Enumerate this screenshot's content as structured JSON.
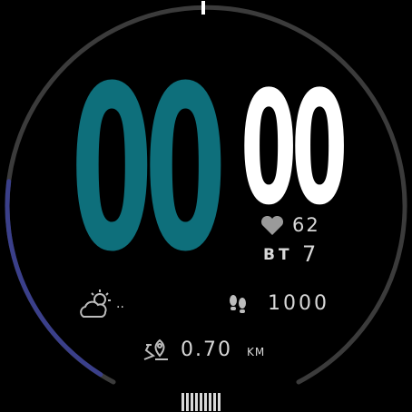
{
  "time": {
    "hours": "00",
    "minutes": "00"
  },
  "stats": {
    "heart_rate": "62",
    "bt_label": "BT",
    "bt_value": "7",
    "weather_value": "..",
    "steps": "1000",
    "distance_value": "0.70",
    "distance_unit": "KM"
  },
  "progress": {
    "left_arc_fraction": 0.22
  },
  "icons": {
    "heart": "heart-icon",
    "weather": "partly-cloudy-icon",
    "steps": "footprints-icon",
    "distance": "location-route-icon",
    "battery": "battery-icon"
  },
  "colors": {
    "background": "#000000",
    "hours": "#0e6f7b",
    "minutes": "#ffffff",
    "ring": "#3b3b3b",
    "progress": "#3a3f8a",
    "text": "#d8d8d8",
    "marker": "#ffffff"
  }
}
